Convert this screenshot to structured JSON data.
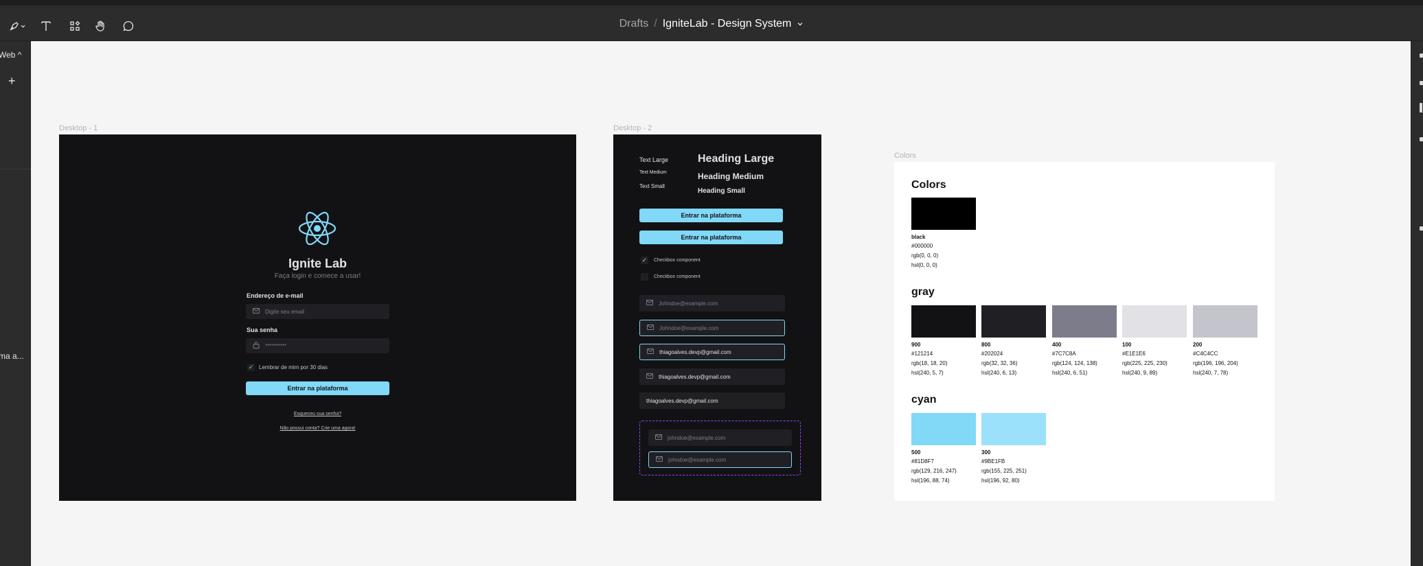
{
  "toolbar": {
    "breadcrumb_parent": "Drafts",
    "breadcrumb_separator": "/",
    "file_title": "IgniteLab - Design System",
    "tools": [
      "pen-tool-icon",
      "text-tool-icon",
      "resources-icon",
      "hand-tool-icon",
      "comment-icon"
    ]
  },
  "left_panel": {
    "page_label": "Web ^",
    "add_label": "+",
    "layer_label": "ma a..."
  },
  "frames": {
    "desktop1_label": "Desktop - 1",
    "desktop2_label": "Desktop - 2",
    "colors_label": "Colors"
  },
  "login": {
    "title": "Ignite Lab",
    "subtitle": "Faça login e comece a usar!",
    "email_label": "Endereço de e-mail",
    "email_placeholder": "Digite seu email",
    "password_label": "Sua senha",
    "password_value": "**********",
    "remember_label": "Lembrar de mim por 30 dias",
    "submit_label": "Entrar na plataforma",
    "forgot_link": "Esqueceu sua senha?",
    "signup_link": "Não possui conta? Crie uma agora!"
  },
  "components": {
    "text_large": "Text Large",
    "text_medium": "Text Medium",
    "text_small": "Text Small",
    "heading_large": "Heading Large",
    "heading_medium": "Heading Medium",
    "heading_small": "Heading Small",
    "button1": "Entrar na plataforma",
    "button2": "Entrar na plataforma",
    "checkbox_checked": "Checkbox component",
    "checkbox_unchecked": "Checkbox component",
    "input_placeholder_1": "Johndoe@example.com",
    "input_placeholder_2": "Johndoe@example.com",
    "input_filled_focus": "thiagoalves.devp@gmail.com",
    "input_filled": "thiagoalves.devp@gmail.com",
    "input_no_icon": "thiagoalves.devp@gmail.com",
    "variant_placeholder_1": "johndoe@example.com",
    "variant_placeholder_2": "johndoe@example.com"
  },
  "colors": {
    "title": "Colors",
    "black": {
      "section": "",
      "swatches": [
        {
          "name": "black",
          "hex": "#000000",
          "rgb": "rgb(0, 0, 0)",
          "hsl": "hsl(0, 0, 0)",
          "color": "#000000"
        }
      ]
    },
    "gray": {
      "section": "gray",
      "swatches": [
        {
          "name": "900",
          "hex": "#121214",
          "rgb": "rgb(18, 18, 20)",
          "hsl": "hsl(240, 5, 7)",
          "color": "#121214"
        },
        {
          "name": "800",
          "hex": "#202024",
          "rgb": "rgb(32, 32, 36)",
          "hsl": "hsl(240, 6, 13)",
          "color": "#202024"
        },
        {
          "name": "400",
          "hex": "#7C7C8A",
          "rgb": "rgb(124, 124, 138)",
          "hsl": "hsl(240, 6, 51)",
          "color": "#7C7C8A"
        },
        {
          "name": "100",
          "hex": "#E1E1E6",
          "rgb": "rgb(225, 225, 230)",
          "hsl": "hsl(240, 9, 89)",
          "color": "#E1E1E6"
        },
        {
          "name": "200",
          "hex": "#C4C4CC",
          "rgb": "rgb(196, 196, 204)",
          "hsl": "hsl(240, 7, 78)",
          "color": "#C4C4CC"
        }
      ]
    },
    "cyan": {
      "section": "cyan",
      "swatches": [
        {
          "name": "500",
          "hex": "#81D8F7",
          "rgb": "rgb(129, 216, 247)",
          "hsl": "hsl(196, 88, 74)",
          "color": "#81D8F7"
        },
        {
          "name": "300",
          "hex": "#9BE1FB",
          "rgb": "rgb(155, 225, 251)",
          "hsl": "hsl(196, 92, 80)",
          "color": "#9BE1FB"
        }
      ]
    }
  },
  "theme": {
    "accent": "#81D8F7",
    "canvas": "#F5F5F5",
    "editor_chrome": "#2C2C2C",
    "frame_bg": "#121214",
    "selection": "#9747FF"
  }
}
